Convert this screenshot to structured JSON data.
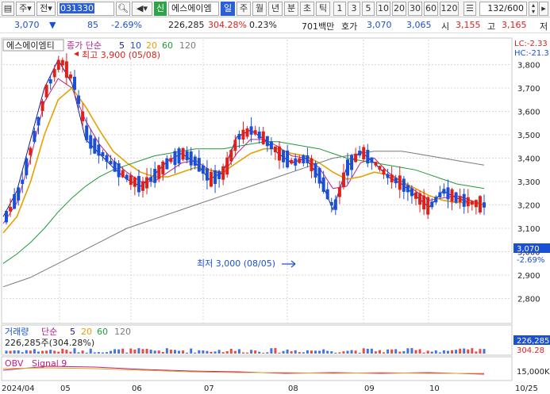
{
  "toolbar": {
    "menu_label": "주",
    "nav_label": "전",
    "code_value": "031330",
    "sin_badge": "신",
    "stock_name": "에스에이엠",
    "periods": [
      "일",
      "주",
      "월",
      "년",
      "분",
      "초",
      "틱"
    ],
    "numbers": [
      "1",
      "3",
      "5",
      "10",
      "20",
      "30",
      "60",
      "120"
    ],
    "page_counter": "132/600"
  },
  "quote": {
    "price": "3,070",
    "change_arrow": "▼",
    "change": "85",
    "change_pct": "-2.69%",
    "volume": "226,285",
    "volume_ratio": "304.28%",
    "turnover_pct": "0.23%",
    "trade_value": "701백만",
    "hoga_label": "호가",
    "bid_price": "3,070",
    "ask_price": "3,065",
    "open_label": "시",
    "open_price": "3,155",
    "high_label": "고",
    "high_price": "3,165",
    "low_label": "저"
  },
  "legend": {
    "stock_name": "에스에이엠티",
    "ma_label": "종가 단순",
    "ma_periods": [
      "5",
      "10",
      "20",
      "60",
      "120"
    ],
    "lc": "LC:-2.33",
    "hc": "HC:-21.3"
  },
  "annotations": {
    "high": "최고 3,900 (05/08)",
    "low": "최저 3,000 (08/05)"
  },
  "price_labels": {
    "current": "3,070",
    "change_pct": "-2.69%"
  },
  "volume_panel": {
    "label": "거래량",
    "ma_label": "단순",
    "ma_periods": [
      "5",
      "20",
      "60",
      "120"
    ],
    "value_text": "226,285주(304.28%)",
    "tag_value": "226,285",
    "tag_pct": "304.28"
  },
  "obv_panel": {
    "label": "OBV",
    "signal": "Signal 9",
    "tick": "15,000K"
  },
  "colors": {
    "up": "#e0201b",
    "down": "#1a4fd6",
    "ma5": "#1a1a8c",
    "ma10": "#c0208a",
    "ma20": "#e8a000",
    "ma60": "#1f9a3a",
    "ma120": "#7a7a7a"
  },
  "chart_data": [
    {
      "type": "candlestick",
      "ylim": [
        2700,
        3900
      ],
      "y_ticks": [
        2800,
        2900,
        3000,
        3100,
        3200,
        3300,
        3400,
        3500,
        3600,
        3700,
        3800
      ],
      "x_labels": [
        "2024/04",
        "05",
        "06",
        "07",
        "08",
        "09",
        "10",
        "10/25"
      ],
      "high": {
        "value": 3900,
        "date": "05/08"
      },
      "low": {
        "value": 3000,
        "date": "08/05"
      },
      "last": 3070,
      "series": [
        {
          "name": "5",
          "values": [
            3150,
            3260,
            3480,
            3700,
            3820,
            3720,
            3480,
            3420,
            3360,
            3310,
            3280,
            3330,
            3390,
            3420,
            3380,
            3310,
            3340,
            3490,
            3520,
            3480,
            3420,
            3380,
            3400,
            3320,
            3180,
            3360,
            3430,
            3380,
            3320,
            3290,
            3240,
            3190,
            3260,
            3230,
            3210,
            3200
          ]
        },
        {
          "name": "10",
          "values": [
            3120,
            3210,
            3400,
            3640,
            3740,
            3700,
            3560,
            3460,
            3390,
            3340,
            3300,
            3300,
            3340,
            3380,
            3390,
            3350,
            3330,
            3420,
            3480,
            3480,
            3450,
            3410,
            3400,
            3360,
            3270,
            3280,
            3380,
            3400,
            3340,
            3300,
            3260,
            3220,
            3230,
            3240,
            3220,
            3200
          ]
        },
        {
          "name": "20",
          "values": [
            3080,
            3150,
            3300,
            3500,
            3650,
            3700,
            3620,
            3520,
            3430,
            3380,
            3340,
            3320,
            3320,
            3340,
            3360,
            3350,
            3340,
            3380,
            3420,
            3440,
            3440,
            3420,
            3410,
            3380,
            3340,
            3310,
            3320,
            3340,
            3330,
            3300,
            3270,
            3240,
            3220,
            3210,
            3210,
            3200
          ]
        },
        {
          "name": "60",
          "values": [
            2950,
            2990,
            3040,
            3100,
            3170,
            3230,
            3280,
            3320,
            3350,
            3370,
            3390,
            3410,
            3420,
            3430,
            3440,
            3440,
            3440,
            3450,
            3460,
            3470,
            3470,
            3460,
            3450,
            3440,
            3420,
            3400,
            3390,
            3380,
            3370,
            3360,
            3350,
            3330,
            3310,
            3290,
            3280,
            3270
          ]
        },
        {
          "name": "120",
          "values": [
            2850,
            2870,
            2890,
            2920,
            2950,
            2980,
            3010,
            3040,
            3070,
            3100,
            3120,
            3140,
            3160,
            3180,
            3200,
            3220,
            3240,
            3260,
            3280,
            3300,
            3320,
            3340,
            3360,
            3380,
            3400,
            3410,
            3420,
            3430,
            3430,
            3430,
            3420,
            3410,
            3400,
            3390,
            3380,
            3370
          ]
        }
      ]
    }
  ]
}
